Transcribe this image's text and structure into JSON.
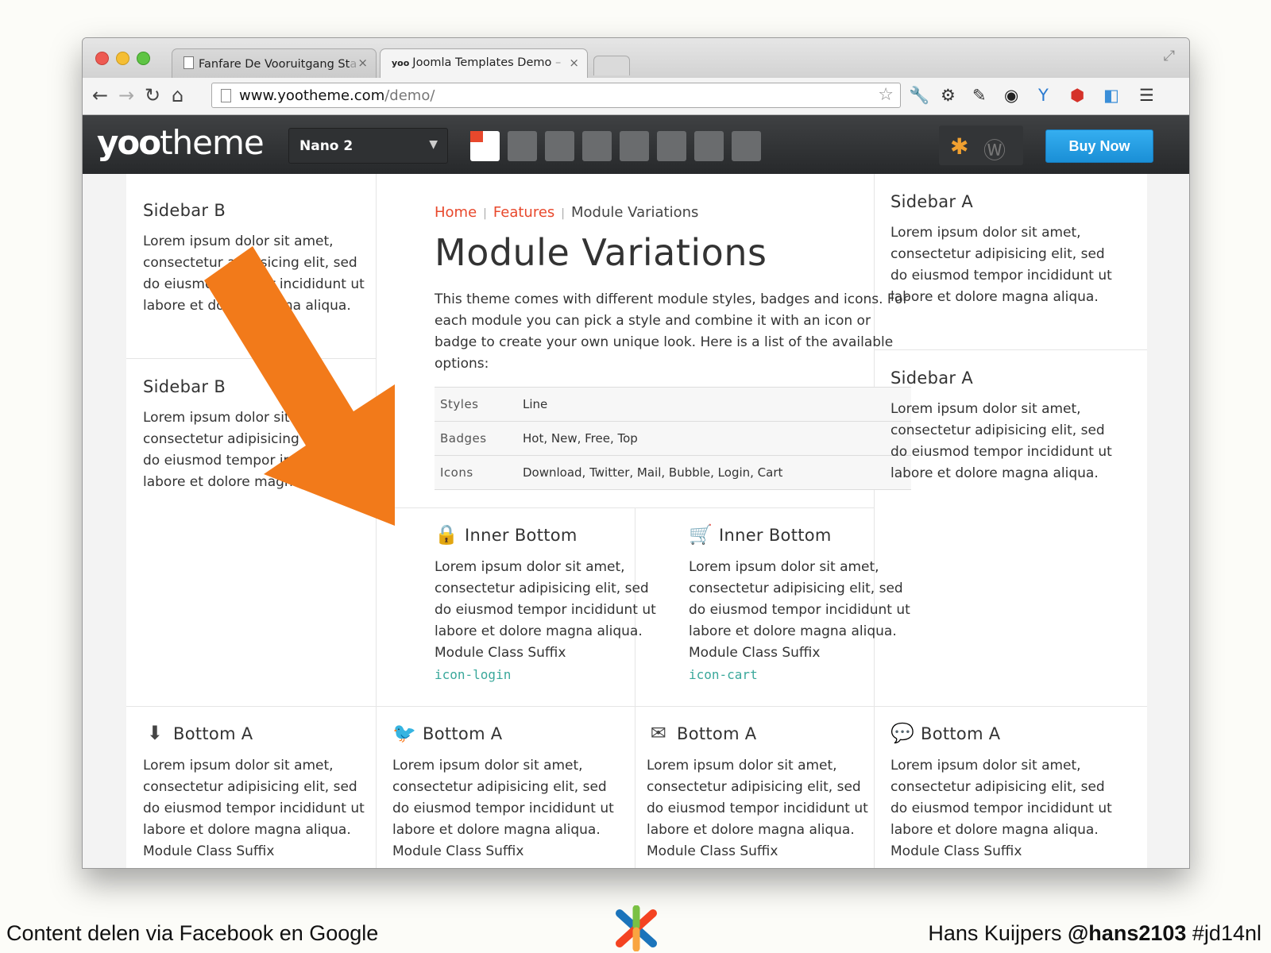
{
  "browser": {
    "tabs": [
      {
        "title": "Fanfare De Vooruitgang St",
        "fade": "a",
        "close": "×"
      },
      {
        "title": "Joomla Templates Demo",
        "fade": " –",
        "close": "×",
        "favicon": "yoo"
      }
    ],
    "url_host": "www.yootheme.com",
    "url_path": "/demo/"
  },
  "site": {
    "logo_bold": "yoo",
    "logo_rest": "theme",
    "style_select": "Nano 2",
    "buy_now": "Buy Now"
  },
  "sidebar_b": [
    {
      "title": "Sidebar B",
      "text": "Lorem ipsum dolor sit amet, consectetur adipisicing elit, sed do eiusmod tempor incididunt ut labore et dolore magna aliqua."
    },
    {
      "title": "Sidebar B",
      "text": "Lorem ipsum dolor sit amet, consectetur adipisicing elit, sed do eiusmod tempor incididunt ut labore et dolore magna aliqua."
    }
  ],
  "sidebar_a": [
    {
      "title": "Sidebar A",
      "text": "Lorem ipsum dolor sit amet, consectetur adipisicing elit, sed do eiusmod tempor incididunt ut labore et dolore magna aliqua."
    },
    {
      "title": "Sidebar A",
      "text": "Lorem ipsum dolor sit amet, consectetur adipisicing elit, sed do eiusmod tempor incididunt ut labore et dolore magna aliqua."
    }
  ],
  "main": {
    "breadcrumb": {
      "home": "Home",
      "features": "Features",
      "sep": "|",
      "current": "Module Variations"
    },
    "title": "Module Variations",
    "intro": "This theme comes with different module styles, badges and icons. For each module you can pick a style and combine it with an icon or badge to create your own unique look. Here is a list of the available options:",
    "options": [
      {
        "key": "Styles",
        "value": "Line"
      },
      {
        "key": "Badges",
        "value": "Hot, New, Free, Top"
      },
      {
        "key": "Icons",
        "value": "Download, Twitter, Mail, Bubble, Login, Cart"
      }
    ]
  },
  "inner_bottom": [
    {
      "title": "Inner Bottom",
      "icon": "lock-icon",
      "text": "Lorem ipsum dolor sit amet, consectetur adipisicing elit, sed do eiusmod tempor incididunt ut labore et dolore magna aliqua. Module Class Suffix",
      "suffix": "icon-login"
    },
    {
      "title": "Inner Bottom",
      "icon": "cart-icon",
      "text": "Lorem ipsum dolor sit amet, consectetur adipisicing elit, sed do eiusmod tempor incididunt ut labore et dolore magna aliqua. Module Class Suffix",
      "suffix": "icon-cart"
    }
  ],
  "bottom_a": [
    {
      "title": "Bottom A",
      "icon": "download-icon",
      "text": "Lorem ipsum dolor sit amet, consectetur adipisicing elit, sed do eiusmod tempor incididunt ut labore et dolore magna aliqua. Module Class Suffix"
    },
    {
      "title": "Bottom A",
      "icon": "twitter-icon",
      "text": "Lorem ipsum dolor sit amet, consectetur adipisicing elit, sed do eiusmod tempor incididunt ut labore et dolore magna aliqua. Module Class Suffix"
    },
    {
      "title": "Bottom A",
      "icon": "mail-icon",
      "text": "Lorem ipsum dolor sit amet, consectetur adipisicing elit, sed do eiusmod tempor incididunt ut labore et dolore magna aliqua. Module Class Suffix"
    },
    {
      "title": "Bottom A",
      "icon": "bubble-icon",
      "text": "Lorem ipsum dolor sit amet, consectetur adipisicing elit, sed do eiusmod tempor incididunt ut labore et dolore magna aliqua. Module Class Suffix"
    }
  ],
  "slide": {
    "footer_left": "Content delen via Facebook en Google",
    "footer_name": "Hans Kuijpers ",
    "footer_handle": "@hans2103",
    "footer_tag": " #jd14nl"
  },
  "colors": {
    "accent_red": "#e8482c",
    "button_blue": "#1a8fd6",
    "arrow_orange": "#f27a1a",
    "suffix_teal": "#3aa89b"
  }
}
